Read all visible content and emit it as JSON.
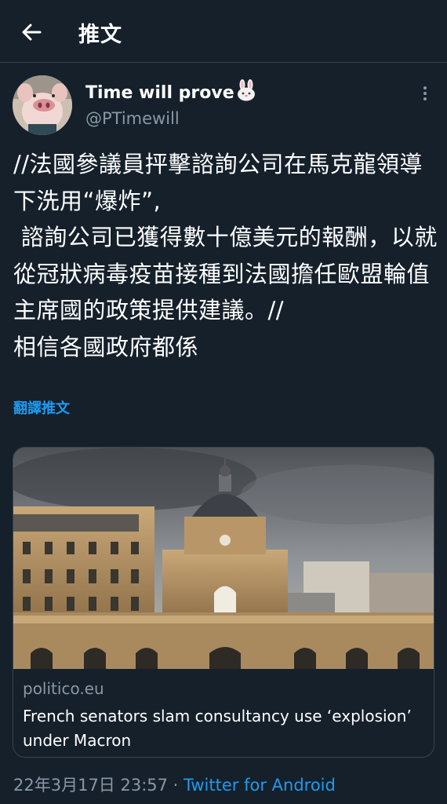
{
  "header": {
    "title": "推文"
  },
  "author": {
    "display_name": "Time will prove",
    "handle": "@PTimewill"
  },
  "tweet": {
    "text": "//法國參議員抨擊諮詢公司在馬克龍領導下洗用“爆炸”,\n 諮詢公司已獲得數十億美元的報酬，以就從冠狀病毒疫苗接種到法國擔任歐盟輪值主席國的政策提供建議。//\n相信各國政府都係",
    "translate_label": "翻譯推文"
  },
  "card": {
    "domain": "politico.eu",
    "title": "French senators slam consultancy use ‘explosion’ under Macron"
  },
  "meta": {
    "timestamp": "22年3月17日 23:57",
    "separator": " · ",
    "source": "Twitter for Android"
  },
  "colors": {
    "background": "#15202b",
    "border": "#38444d",
    "secondary_text": "#8899a6",
    "accent": "#1d9bf0"
  },
  "icons": {
    "back": "arrow-left-icon",
    "more": "more-vertical-icon",
    "emoji": "rabbit-face-emoji"
  }
}
